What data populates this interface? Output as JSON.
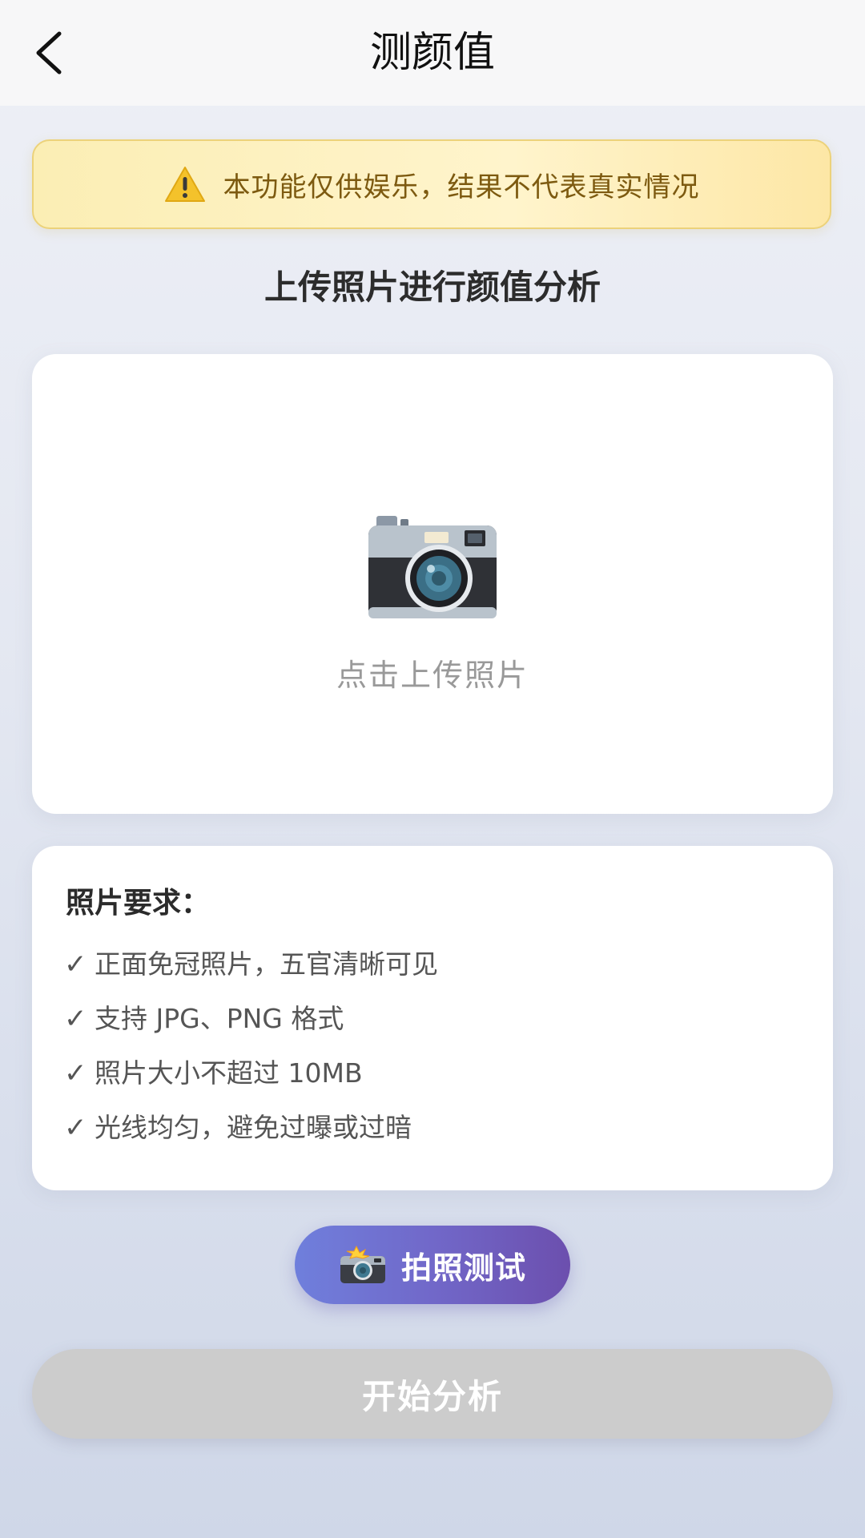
{
  "nav": {
    "title": "测颜值",
    "back_icon": "chevron-left-icon"
  },
  "notice": {
    "icon": "warning-icon",
    "text": "本功能仅供娱乐，结果不代表真实情况"
  },
  "section": {
    "title": "上传照片进行颜值分析"
  },
  "upload": {
    "icon": "camera-icon",
    "label": "点击上传照片"
  },
  "requirements": {
    "title": "照片要求：",
    "check_glyph": "✓",
    "items": [
      "正面免冠照片，五官清晰可见",
      "支持 JPG、PNG 格式",
      "照片大小不超过 10MB",
      "光线均匀，避免过曝或过暗"
    ]
  },
  "buttons": {
    "photo_icon": "camera-flash-icon",
    "photo_label": "拍照测试",
    "start_label": "开始分析",
    "start_disabled": true
  },
  "colors": {
    "notice_bg": "#fbeeb4",
    "notice_text": "#7d5a10",
    "photo_btn_start": "#6f7fdc",
    "photo_btn_end": "#6c4fae",
    "start_btn_disabled": "#cccccc"
  }
}
